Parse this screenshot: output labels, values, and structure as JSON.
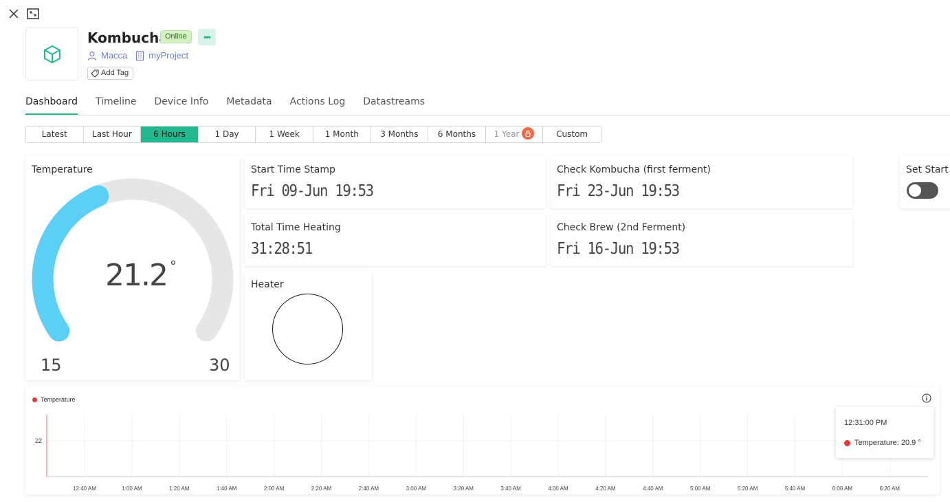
{
  "device": {
    "name": "Kombucha",
    "status": "Online",
    "owner": "Macca",
    "project": "myProject",
    "add_tag": "Add Tag"
  },
  "tabs": [
    "Dashboard",
    "Timeline",
    "Device Info",
    "Metadata",
    "Actions Log",
    "Datastreams"
  ],
  "active_tab": "Dashboard",
  "time_ranges": [
    "Latest",
    "Last Hour",
    "6 Hours",
    "1 Day",
    "1 Week",
    "1 Month",
    "3 Months",
    "6 Months",
    "1 Year",
    "Custom"
  ],
  "active_range": "6 Hours",
  "locked_range": "1 Year",
  "widgets": {
    "temperature": {
      "label": "Temperature",
      "value": "21.2",
      "unit": "°",
      "min": "15",
      "max": "30",
      "level": 0.41
    },
    "start_time": {
      "label": "Start Time Stamp",
      "value": "Fri 09-Jun 19:53"
    },
    "total_heating": {
      "label": "Total Time Heating",
      "value": "31:28:51"
    },
    "check_kombucha": {
      "label": "Check Kombucha (first ferment)",
      "value": "Fri 23-Jun 19:53"
    },
    "check_brew": {
      "label": "Check Brew (2nd Ferment)",
      "value": "Fri 16-Jun 19:53"
    },
    "heater": {
      "label": "Heater",
      "on": false
    },
    "set_start": {
      "label": "Set Start T",
      "on": false
    }
  },
  "colors": {
    "accent": "#23b98e",
    "gauge_fill": "#5ccff6",
    "gauge_track": "#e6e6e6",
    "series": "#e53935"
  },
  "chart": {
    "legend": "Temperature",
    "tooltip_time": "12:31:00 PM",
    "tooltip_value": "Temperature: 20.9 °"
  },
  "chart_data": {
    "type": "line",
    "title": "",
    "series": [
      {
        "name": "Temperature",
        "x": [
          "12:31 AM",
          "12:31 AM"
        ],
        "values": [
          20.9,
          22.2
        ]
      }
    ],
    "x_ticks": [
      "12:40 AM",
      "1:00 AM",
      "1:20 AM",
      "1:40 AM",
      "2:00 AM",
      "2:20 AM",
      "2:40 AM",
      "3:00 AM",
      "3:20 AM",
      "3:40 AM",
      "4:00 AM",
      "4:20 AM",
      "4:40 AM",
      "5:00 AM",
      "5:20 AM",
      "5:40 AM",
      "6:00 AM",
      "6:20 AM"
    ],
    "y_ticks": [
      "22"
    ],
    "grid": true,
    "legend_position": "top-left"
  }
}
